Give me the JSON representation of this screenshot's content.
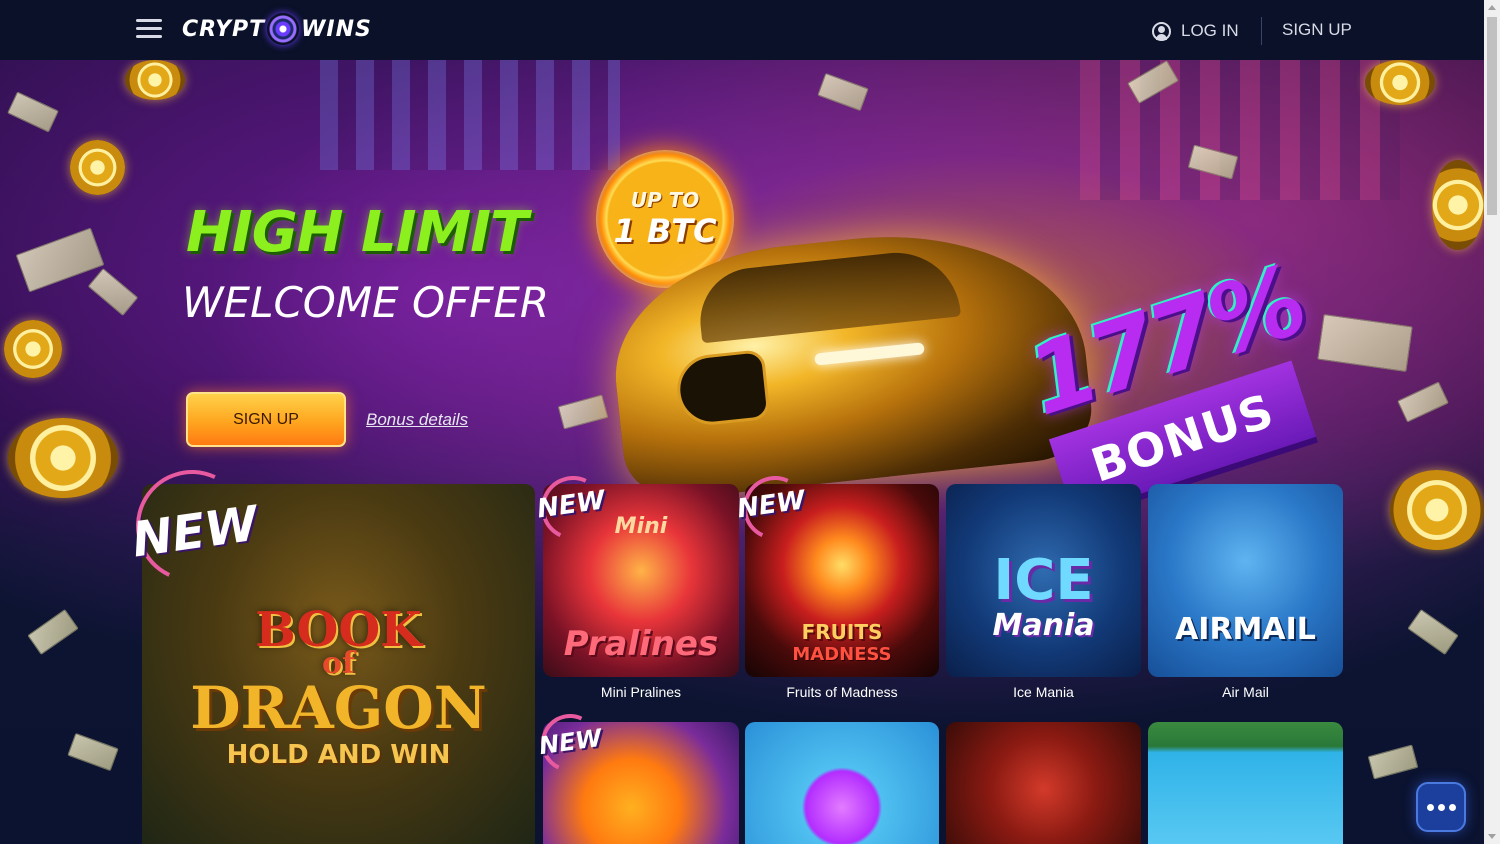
{
  "header": {
    "logo_left": "CRYPT",
    "logo_right": "WINS",
    "login_label": "LOG IN",
    "signup_label": "SIGN UP"
  },
  "hero": {
    "title": "HIGH LIMIT",
    "subtitle": "WELCOME OFFER",
    "badge_line1": "UP TO",
    "badge_line2": "1 BTC",
    "bonus_percent": "177%",
    "bonus_word": "BONUS",
    "cta_label": "SIGN UP",
    "details_link": "Bonus details"
  },
  "featured": {
    "new_label": "NEW",
    "art_line1": "BOOK",
    "art_line2": "of",
    "art_line3": "DRAGON",
    "art_line4": "HOLD AND WIN"
  },
  "games": [
    {
      "name": "Mini Pralines",
      "art": "Pralines",
      "art2": "Mini",
      "new": "NEW"
    },
    {
      "name": "Fruits of Madness",
      "art": "FRUITS",
      "art2": "MADNESS",
      "new": "NEW"
    },
    {
      "name": "Ice Mania",
      "art": "ICE",
      "art2": "Mania"
    },
    {
      "name": "Air Mail",
      "art": "AIRMAIL"
    }
  ],
  "row2": [
    {
      "new": "NEW"
    }
  ],
  "colors": {
    "accent_green": "#8cf01e",
    "cta_orange": "#ffa51f",
    "bonus_purple": "#b72cf0",
    "header_bg": "#0a1128"
  },
  "icons": [
    "hamburger-menu-icon",
    "user-icon",
    "chat-icon"
  ]
}
